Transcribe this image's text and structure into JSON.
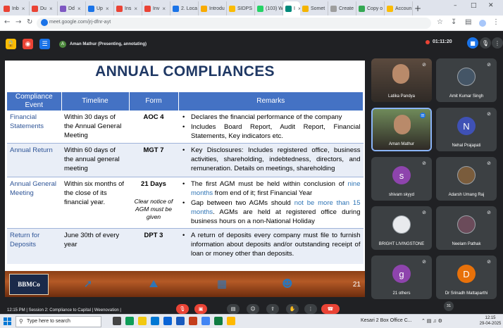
{
  "browser": {
    "tabs": [
      {
        "label": "Inb",
        "color": "#ea4335"
      },
      {
        "label": "Du",
        "color": "#ea4335"
      },
      {
        "label": "Dd",
        "color": "#7e57c2"
      },
      {
        "label": "Up",
        "color": "#1a73e8"
      },
      {
        "label": "Ins",
        "color": "#ea4335"
      },
      {
        "label": "Inv",
        "color": "#ea4335"
      },
      {
        "label": "2. Loca",
        "color": "#1a73e8"
      },
      {
        "label": "Introdu",
        "color": "#f9ab00"
      },
      {
        "label": "SIDPS",
        "color": "#fbbc04"
      },
      {
        "label": "(103) W",
        "color": "#25d366"
      },
      {
        "label": "I",
        "color": "#00897b"
      },
      {
        "label": "Somet",
        "color": "#f4b400"
      },
      {
        "label": "Create",
        "color": "#9e9e9e"
      },
      {
        "label": "Copy o",
        "color": "#34a853"
      },
      {
        "label": "Accoun",
        "color": "#fbbc04"
      }
    ],
    "active_tab_index": 10,
    "new_tab": "+",
    "url": "meet.google.com/jrj-dfnr-ayt",
    "window_controls": {
      "minimize": "–",
      "maximize": "□",
      "close": "✕"
    }
  },
  "meet": {
    "presenter_label": "Aman Mathur (Presenting, annotating)",
    "presenter_initial": "A",
    "timer": "01:11:20",
    "top_icons": [
      "lock-icon",
      "record-icon",
      "doc-icon"
    ],
    "bottom_status": "12:15 PM  |  Session 2: Compliance to Capital | Weenovation |",
    "controls": [
      "mic-off",
      "cam-off",
      "emoji",
      "present",
      "raise-hand",
      "more",
      "end-call"
    ],
    "badge_count": "31"
  },
  "slide": {
    "title": "ANNUAL COMPLIANCES",
    "headers": [
      "Compliance Event",
      "Timeline",
      "Form",
      "Remarks"
    ],
    "rows": [
      {
        "event": "Financial Statements",
        "timeline": "Within 30 days of the Annual General Meeting",
        "form": "AOC 4",
        "note": "",
        "remarks": [
          {
            "t": "Declares the financial performance of the company",
            "h": ""
          },
          {
            "t": "Includes Board Report, Audit Report, Financial Statements, Key indicators etc.",
            "h": ""
          }
        ]
      },
      {
        "event": "Annual Return",
        "timeline": "Within 60 days of the annual general meeting",
        "form": "MGT 7",
        "note": "",
        "remarks": [
          {
            "t": "Key Disclosures: Includes registered office, business activities, shareholding, indebtedness, directors, and remuneration. Details on meetings, shareholding",
            "h": ""
          }
        ]
      },
      {
        "event": "Annual General Meeting",
        "timeline": "Within six months of the close of its financial year.",
        "form": "21 Days",
        "note": "Clear notice of AGM must be given",
        "remarks": [
          {
            "t": "The first AGM must be held within conclusion of ",
            "h": "nine months",
            "t2": " from end of it; first Financial Year"
          },
          {
            "t": "Gap between two AGMs should ",
            "h": "not be more than 15 months",
            "t2": ". AGMs are held at registered office during business hours on a non-National Holiday"
          }
        ]
      },
      {
        "event": "Return for Deposits",
        "timeline": "June 30th of every year",
        "form": "DPT 3",
        "note": "",
        "remarks": [
          {
            "t": "A return of deposits every company must file to furnish information about deposits and/or outstanding receipt of loan or money other than deposits.",
            "h": ""
          }
        ]
      }
    ],
    "logo": "BBMCo",
    "page_number": "21",
    "footer_icons": [
      "rocket-icon",
      "factory-icon",
      "building-icon",
      "people-network-icon"
    ]
  },
  "participants": [
    {
      "name": "Latika Pandya",
      "initial": "",
      "color": "#5b4a3e",
      "photo": true
    },
    {
      "name": "Amit Kumar Singh",
      "initial": "",
      "color": "#445566",
      "photo": true
    },
    {
      "name": "Aman Mathur",
      "initial": "",
      "color": "#6f8a5a",
      "photo": true,
      "speaking": true
    },
    {
      "name": "Nehal Prajapati",
      "initial": "N",
      "color": "#3f51b5"
    },
    {
      "name": "shivam skyyd",
      "initial": "s",
      "color": "#8e44ad"
    },
    {
      "name": "Adarsh Umang Raj",
      "initial": "",
      "color": "#7a5c3c",
      "photo": true
    },
    {
      "name": "BRIGHT LIVINGSTONE",
      "initial": "",
      "color": "#e8eaed",
      "photo": true
    },
    {
      "name": "Neelam Pathak",
      "initial": "",
      "color": "#6b4b5a",
      "photo": true
    },
    {
      "name": "21 others",
      "initial": "g",
      "color": "#8e44ad"
    },
    {
      "name": "Dr Srinadh Mattaparthi",
      "initial": "D",
      "color": "#e8710a"
    }
  ],
  "taskbar": {
    "search_placeholder": "Type here to search",
    "tray_text": "Kesari 2 Box Office C...",
    "time": "12:15",
    "date": "29-04-2025"
  }
}
